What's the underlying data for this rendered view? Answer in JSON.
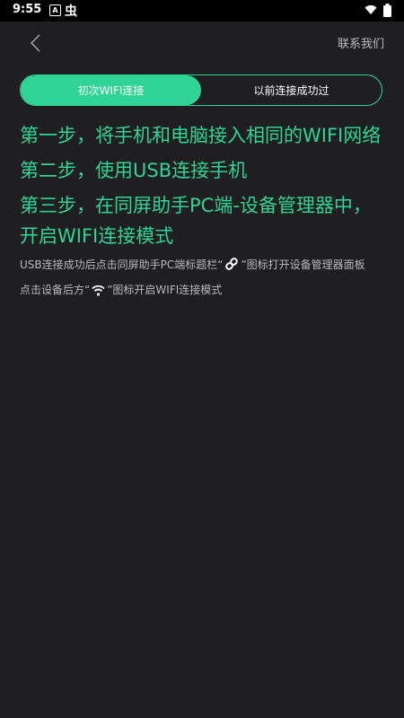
{
  "status_bar": {
    "time": "9:55",
    "icon_a": "A",
    "icon_b": "虫",
    "icons": [
      "wifi-icon",
      "battery-icon"
    ]
  },
  "header": {
    "back_icon": "chevron-left-icon",
    "contact_label": "联系我们"
  },
  "tabs": [
    {
      "label": "初次WIFI连接",
      "active": true
    },
    {
      "label": "以前连接成功过",
      "active": false
    }
  ],
  "steps": [
    "第一步，将手机和电脑接入相同的WIFI网络",
    "第二步，使用USB连接手机",
    "第三步，在同屏助手PC端-设备管理器中，开启WIFI连接模式"
  ],
  "hints": {
    "hint1_before": "USB连接成功后点击同屏助手PC端标题栏“",
    "hint1_icon": "link-icon",
    "hint1_after": "”图标打开设备管理器面板",
    "hint2_before": "点击设备后方“",
    "hint2_icon": "wifi-icon",
    "hint2_after": "”图标开启WIFI连接模式"
  },
  "colors": {
    "accent": "#2fd496",
    "background": "#1f1f21",
    "hint_text": "#b9b9b9"
  }
}
